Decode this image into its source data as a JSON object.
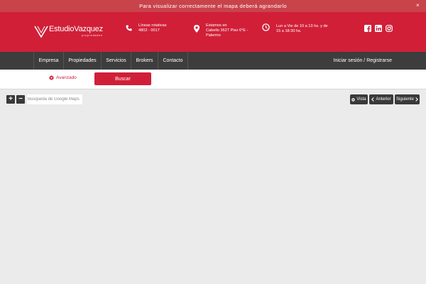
{
  "notice": {
    "text": "Para visualizar correctamente el mapa deberá agrandarlo",
    "close": "×"
  },
  "header": {
    "logo_main": "EstudioVazquez",
    "logo_sub": "propiedades",
    "phone": {
      "line1": "Líneas rotativas",
      "line2": "4802 - 0017"
    },
    "address": {
      "line1": "Estamos en",
      "line2": "Cabello 3627 Piso 6°E -",
      "line3": "Palermo"
    },
    "hours": {
      "line1": "Lun a Vie de 10 a 13 hs. y de",
      "line2": "15 a 18:30 hs."
    },
    "icons": [
      "phone-icon",
      "location-pin-icon",
      "clock-icon",
      "facebook-icon",
      "linkedin-icon",
      "instagram-icon"
    ]
  },
  "nav": {
    "items": [
      {
        "label": "Empresa"
      },
      {
        "label": "Propiedades"
      },
      {
        "label": "Servicios"
      },
      {
        "label": "Brokers"
      },
      {
        "label": "Contacto"
      }
    ],
    "login": "Iniciar sesión / Registrarse"
  },
  "search": {
    "advanced": "Avanzado",
    "button": "Buscar"
  },
  "map": {
    "zoom_in": "+",
    "zoom_out": "−",
    "search_placeholder": "Búsqueda de Google Maps",
    "view": "Vista",
    "prev": "Anterior",
    "next": "Siguiente"
  },
  "colors": {
    "brand": "#d11f38",
    "notice": "#c9434a",
    "nav": "#3d3d3d",
    "map_bg": "#ebebeb"
  }
}
